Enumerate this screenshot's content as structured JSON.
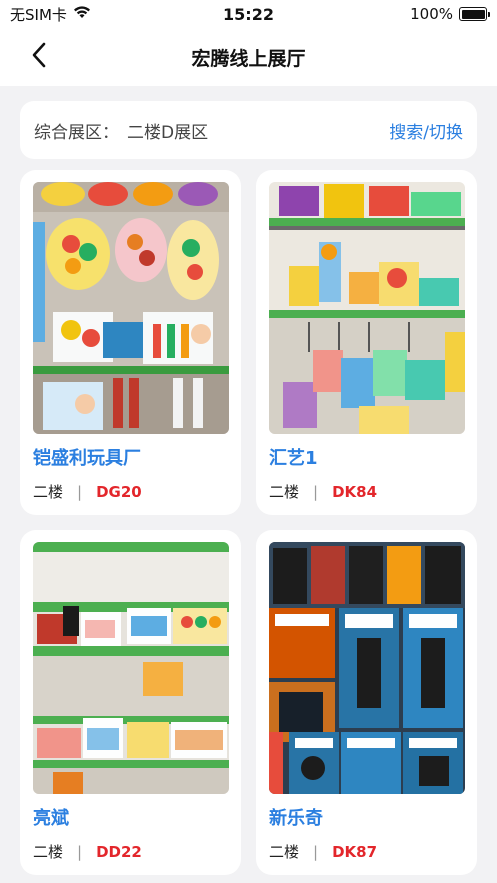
{
  "status_bar": {
    "carrier": "无SIM卡",
    "time": "15:22",
    "battery": "100%",
    "battery_level": 1.0
  },
  "nav": {
    "title": "宏腾线上展厅",
    "back_icon": "chevron-left-icon"
  },
  "filter": {
    "label": "综合展区：",
    "value": "二楼D展区",
    "action": "搜索/切换"
  },
  "colors": {
    "accent": "#2b7fe0",
    "code": "#e3262b",
    "background": "#f2f2f4"
  },
  "shops": [
    {
      "name": "铠盛利玩具厂",
      "floor": "二楼",
      "separator": "|",
      "code": "DG20"
    },
    {
      "name": "汇艺1",
      "floor": "二楼",
      "separator": "|",
      "code": "DK84"
    },
    {
      "name": "亮斌",
      "floor": "二楼",
      "separator": "|",
      "code": "DD22"
    },
    {
      "name": "新乐奇",
      "floor": "二楼",
      "separator": "|",
      "code": "DK87"
    }
  ]
}
